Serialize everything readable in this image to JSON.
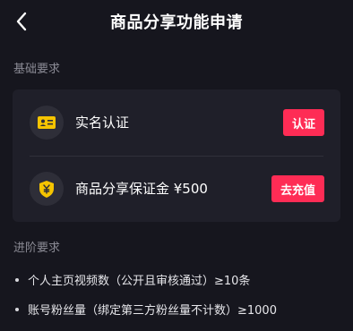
{
  "header": {
    "title": "商品分享功能申请",
    "back_icon": "chevron-left-icon"
  },
  "basic": {
    "section_label": "基础要求",
    "items": [
      {
        "icon": "id-card-icon",
        "label": "实名认证",
        "button_label": "认证"
      },
      {
        "icon": "shield-yen-icon",
        "label": "商品分享保证金 ¥500",
        "button_label": "去充值"
      }
    ]
  },
  "advanced": {
    "section_label": "进阶要求",
    "items": [
      {
        "text": "个人主页视频数（公开且审核通过）≥10条"
      },
      {
        "text": "账号粉丝量（绑定第三方粉丝量不计数）≥1000"
      }
    ]
  },
  "colors": {
    "accent": "#fe2c55",
    "icon_gold": "#f5c400",
    "background": "#16161e",
    "card": "#1f1f29"
  }
}
